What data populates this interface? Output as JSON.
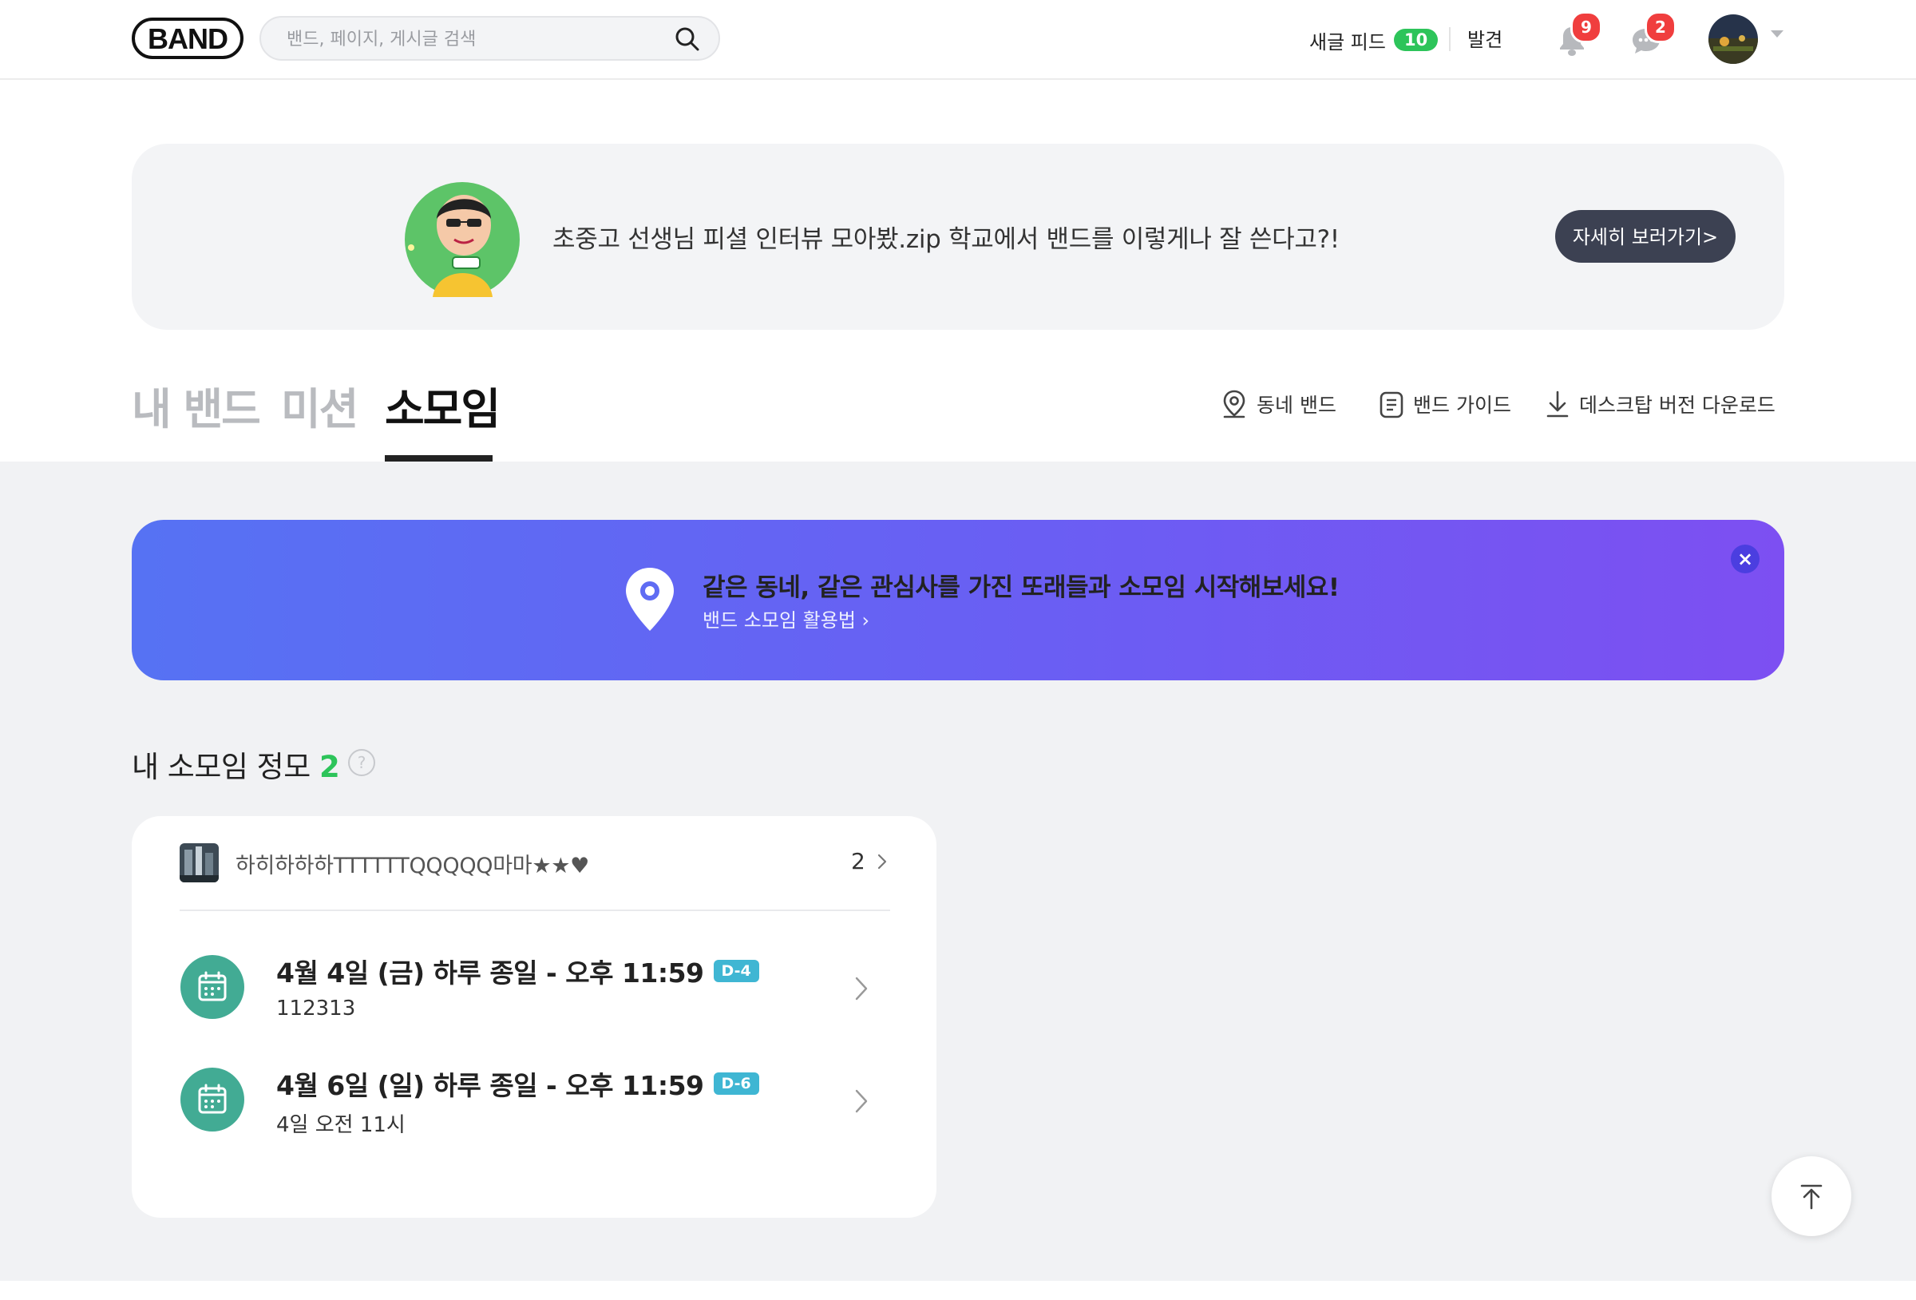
{
  "header": {
    "logo": "BAND",
    "search_placeholder": "밴드, 페이지, 게시글 검색",
    "feed_label": "새글 피드",
    "feed_count": "10",
    "discover_label": "발견",
    "notifications_count": "9",
    "chat_count": "2"
  },
  "promo": {
    "text": "초중고 선생님 피셜 인터뷰 모아봤.zip 학교에서 밴드를 이렇게나 잘 쓴다고?!",
    "button": "자세히 보러가기>"
  },
  "tabs": [
    {
      "label": "내 밴드",
      "active": false
    },
    {
      "label": "미션",
      "active": false
    },
    {
      "label": "소모임",
      "active": true
    }
  ],
  "tools": [
    {
      "label": "동네 밴드",
      "icon": "location-icon"
    },
    {
      "label": "밴드 가이드",
      "icon": "guide-icon"
    },
    {
      "label": "데스크탑 버전 다운로드",
      "icon": "download-icon"
    }
  ],
  "banner": {
    "title": "같은 동네, 같은 관심사를 가진 또래들과 소모임 시작해보세요!",
    "link": "밴드 소모임 활용법 ›",
    "close": "×"
  },
  "section": {
    "title": "내 소모임 정모",
    "count": "2",
    "help": "?"
  },
  "card": {
    "band_name": "하히하하하TTTTTTQQQQQ마마★★♥",
    "band_count": "2",
    "events": [
      {
        "title": "4월 4일 (금) 하루 종일 - 오후 11:59",
        "dday": "D-4",
        "sub": "112313"
      },
      {
        "title": "4월 6일 (일) 하루 종일 - 오후 11:59",
        "dday": "D-6",
        "sub": "4일 오전 11시"
      }
    ]
  },
  "colors": {
    "accent_green": "#2dc45a",
    "badge_red": "#f03e3e",
    "calendar_teal": "#42ab94",
    "dday_blue": "#3fb6d3",
    "banner_from": "#5672f3",
    "banner_to": "#7d4ff2"
  }
}
